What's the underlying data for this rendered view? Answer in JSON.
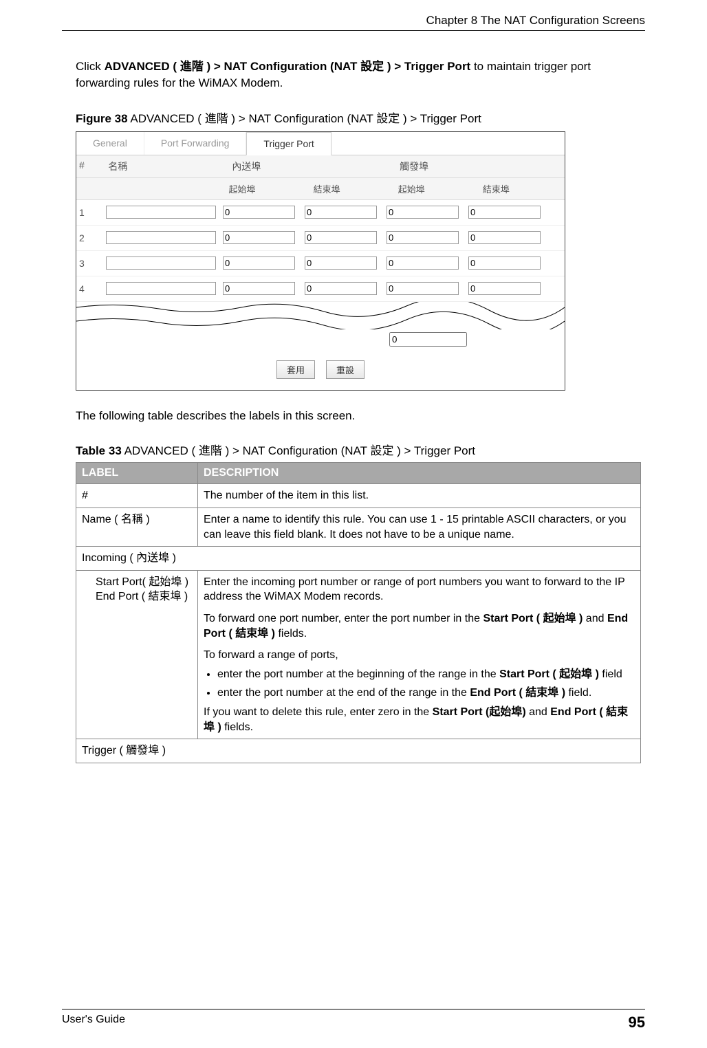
{
  "header": {
    "chapter": "Chapter 8 The NAT Configuration Screens"
  },
  "intro": {
    "prefix": "Click ",
    "path": "ADVANCED ( 進階 ) > NAT Configuration (NAT 設定 ) > Trigger Port",
    "suffix": " to maintain trigger port forwarding rules for the WiMAX Modem."
  },
  "figure": {
    "label": "Figure 38",
    "caption_rest": "   ADVANCED ( 進階 ) > NAT Configuration (NAT 設定 )  > Trigger Port"
  },
  "screenshot": {
    "tabs": [
      "General",
      "Port Forwarding",
      "Trigger Port"
    ],
    "active_tab_index": 2,
    "col_num": "#",
    "col_name": "名稱",
    "group_incoming": "內送埠",
    "group_trigger": "觸發埠",
    "sub_start": "起始埠",
    "sub_end": "結束埠",
    "rows": [
      {
        "n": "1",
        "name": "",
        "p": [
          "0",
          "0",
          "0",
          "0"
        ]
      },
      {
        "n": "2",
        "name": "",
        "p": [
          "0",
          "0",
          "0",
          "0"
        ]
      },
      {
        "n": "3",
        "name": "",
        "p": [
          "0",
          "0",
          "0",
          "0"
        ]
      },
      {
        "n": "4",
        "name": "",
        "p": [
          "0",
          "0",
          "0",
          "0"
        ]
      }
    ],
    "partial_value": "0",
    "btn_apply": "套用",
    "btn_reset": "重設"
  },
  "between_para": "The following table describes the labels in this screen.",
  "table_caption": {
    "label": "Table 33",
    "rest": "   ADVANCED ( 進階 ) > NAT Configuration (NAT 設定 )  > Trigger Port"
  },
  "table": {
    "head_label": "LABEL",
    "head_desc": "DESCRIPTION",
    "rows": {
      "r0_label": "#",
      "r0_desc": "The number of the item in this list.",
      "r1_label": "Name ( 名稱 )",
      "r1_desc": "Enter a name to identify this rule. You can use 1 - 15 printable ASCII characters, or you can leave this field blank. It does not have to be a unique name.",
      "r2_label": "Incoming ( 內送埠 )",
      "r3_label_a": "Start Port( 起始埠 )",
      "r3_label_b": "End Port ( 結束埠 )",
      "r3_p1": "Enter the incoming port number or range of port numbers you want to forward to the IP address the WiMAX Modem records.",
      "r3_p2_pre": "To forward one port number, enter the port number in the ",
      "r3_p2_b1": "Start Port ( 起始埠 )",
      "r3_p2_mid": " and ",
      "r3_p2_b2": "End Port ( 結束埠 )",
      "r3_p2_suf": " fields.",
      "r3_p3": "To forward a range of ports,",
      "r3_li1_pre": "enter the port number at the beginning of the range in the ",
      "r3_li1_b": "Start Port ( 起始埠 )",
      "r3_li1_suf": " field",
      "r3_li2_pre": "enter the port number at the end of the range in the ",
      "r3_li2_b": "End Port ( 結束埠 )",
      "r3_li2_suf": " field.",
      "r3_p4_pre": "If you want to delete this rule, enter zero in the ",
      "r3_p4_b1": "Start Port (起始埠)",
      "r3_p4_mid": " and ",
      "r3_p4_b2": "End Port ( 結束埠 )",
      "r3_p4_suf": " fields.",
      "r4_label": "Trigger ( 觸發埠 )"
    }
  },
  "footer": {
    "guide": "User's Guide",
    "page": "95"
  }
}
